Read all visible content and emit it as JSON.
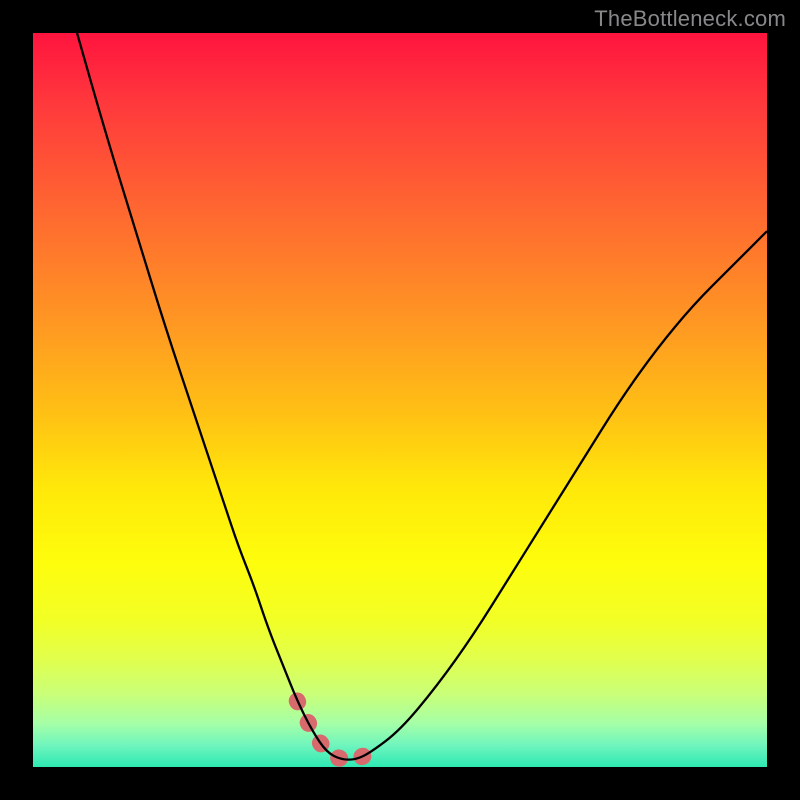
{
  "watermark": "TheBottleneck.com",
  "chart_data": {
    "type": "line",
    "title": "",
    "xlabel": "",
    "ylabel": "",
    "xlim": [
      0,
      100
    ],
    "ylim": [
      0,
      100
    ],
    "grid": false,
    "series": [
      {
        "name": "curve",
        "x": [
          6,
          10,
          14,
          18,
          22,
          26,
          28,
          30,
          32,
          34,
          36,
          38,
          40,
          42,
          44,
          46,
          50,
          55,
          60,
          65,
          70,
          75,
          80,
          85,
          90,
          95,
          100
        ],
        "values": [
          100,
          86,
          73,
          60,
          48,
          36,
          30,
          25,
          19,
          14,
          9,
          5,
          2,
          1,
          1,
          2,
          5,
          11,
          18,
          26,
          34,
          42,
          50,
          57,
          63,
          68,
          73
        ]
      }
    ],
    "annotations": [
      {
        "type": "highlight_segment",
        "x_range": [
          36,
          47
        ],
        "note": "dotted accent at trough"
      }
    ]
  }
}
